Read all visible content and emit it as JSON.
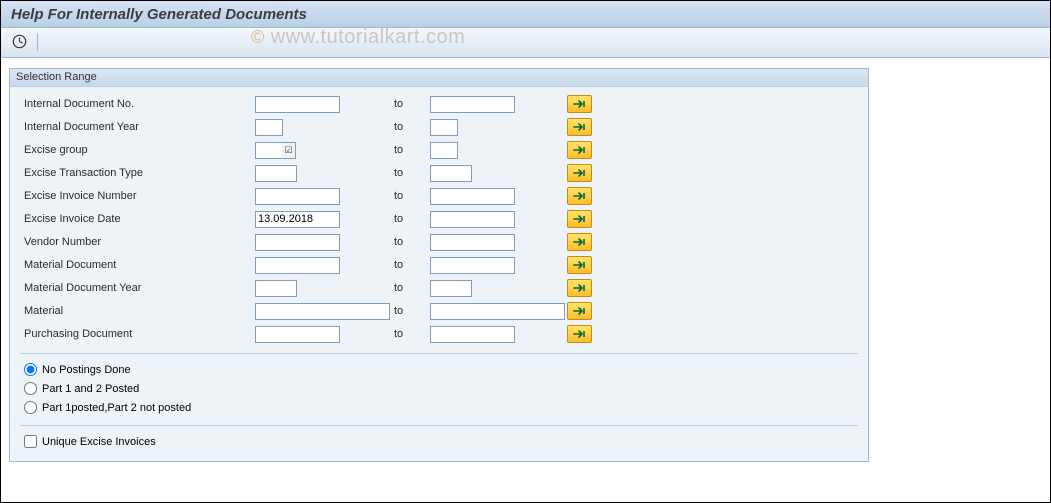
{
  "title": "Help For Internally Generated Documents",
  "watermark": "www.tutorialkart.com",
  "to_label": "to",
  "selection_range": {
    "title": "Selection Range",
    "rows": {
      "internal_doc_no": {
        "label": "Internal Document No.",
        "from": "",
        "to": "",
        "from_w": "w-md",
        "to_w": "w-md",
        "f4": false
      },
      "internal_doc_year": {
        "label": "Internal Document Year",
        "from": "",
        "to": "",
        "from_w": "w-xs",
        "to_w": "w-xs",
        "f4": false
      },
      "excise_group": {
        "label": "Excise group",
        "from": "",
        "to": "",
        "from_w": "w-xs",
        "to_w": "w-xs",
        "f4": true
      },
      "excise_txn_type": {
        "label": "Excise Transaction Type",
        "from": "",
        "to": "",
        "from_w": "w-sm",
        "to_w": "w-sm",
        "f4": false
      },
      "excise_inv_no": {
        "label": "Excise Invoice Number",
        "from": "",
        "to": "",
        "from_w": "w-md",
        "to_w": "w-md",
        "f4": false
      },
      "excise_inv_date": {
        "label": "Excise Invoice Date",
        "from": "13.09.2018",
        "to": "",
        "from_w": "w-md",
        "to_w": "w-md",
        "f4": false
      },
      "vendor_no": {
        "label": "Vendor Number",
        "from": "",
        "to": "",
        "from_w": "w-md",
        "to_w": "w-md",
        "f4": false
      },
      "material_doc": {
        "label": "Material Document",
        "from": "",
        "to": "",
        "from_w": "w-md",
        "to_w": "w-md",
        "f4": false
      },
      "material_doc_year": {
        "label": "Material Document Year",
        "from": "",
        "to": "",
        "from_w": "w-sm",
        "to_w": "w-sm",
        "f4": false
      },
      "material": {
        "label": "Material",
        "from": "",
        "to": "",
        "from_w": "w-long",
        "to_w": "w-long",
        "f4": false
      },
      "purchasing_doc": {
        "label": "Purchasing Document",
        "from": "",
        "to": "",
        "from_w": "w-md",
        "to_w": "w-md",
        "f4": false
      }
    }
  },
  "posting_status": {
    "selected": "none",
    "options": {
      "none": "No Postings Done",
      "both": "Part 1 and 2 Posted",
      "part1": "Part 1posted,Part 2 not posted"
    }
  },
  "unique_excise": {
    "label": "Unique Excise Invoices",
    "checked": false
  }
}
